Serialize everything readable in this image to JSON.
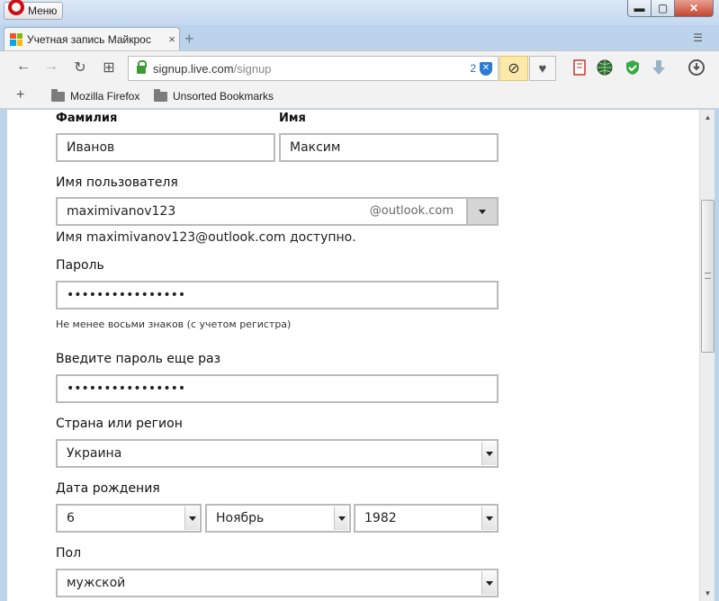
{
  "window": {
    "menu_label": "Меню",
    "min": "▬",
    "max": "▢",
    "close": "✕"
  },
  "tab": {
    "title": "Учетная запись Майкрос",
    "close": "×",
    "new_tab": "+",
    "tab_menu": "☰"
  },
  "address": {
    "host": "signup.live.com",
    "path": "/signup",
    "tracker_count": "2",
    "shield_label": "✕"
  },
  "toolbar": {
    "back": "←",
    "forward": "→",
    "reload": "↻",
    "grid": "⊞",
    "adblock": "⊘",
    "heart": "♥"
  },
  "bookmarks": {
    "add": "+",
    "items": [
      {
        "label": "Mozilla Firefox"
      },
      {
        "label": "Unsorted Bookmarks"
      }
    ]
  },
  "form": {
    "last_name_label": "Фамилия",
    "last_name_value": "Иванов",
    "first_name_label": "Имя",
    "first_name_value": "Максим",
    "username_label": "Имя пользователя",
    "username_value": "maximivanov123",
    "username_domain": "@outlook.com",
    "username_status": "Имя maximivanov123@outlook.com доступно.",
    "password_label": "Пароль",
    "password_value": "••••••••••••••••",
    "password_hint": "Не менее восьми знаков (с учетом регистра)",
    "password2_label": "Введите пароль еще раз",
    "password2_value": "••••••••••••••••",
    "country_label": "Страна или регион",
    "country_value": "Украина",
    "birth_label": "Дата рождения",
    "birth_day": "6",
    "birth_month": "Ноябрь",
    "birth_year": "1982",
    "gender_label": "Пол",
    "gender_value": "мужской"
  },
  "colors": {
    "accent": "#2b7bd3",
    "lock": "#3b9c35",
    "opera": "#cc0f16"
  }
}
